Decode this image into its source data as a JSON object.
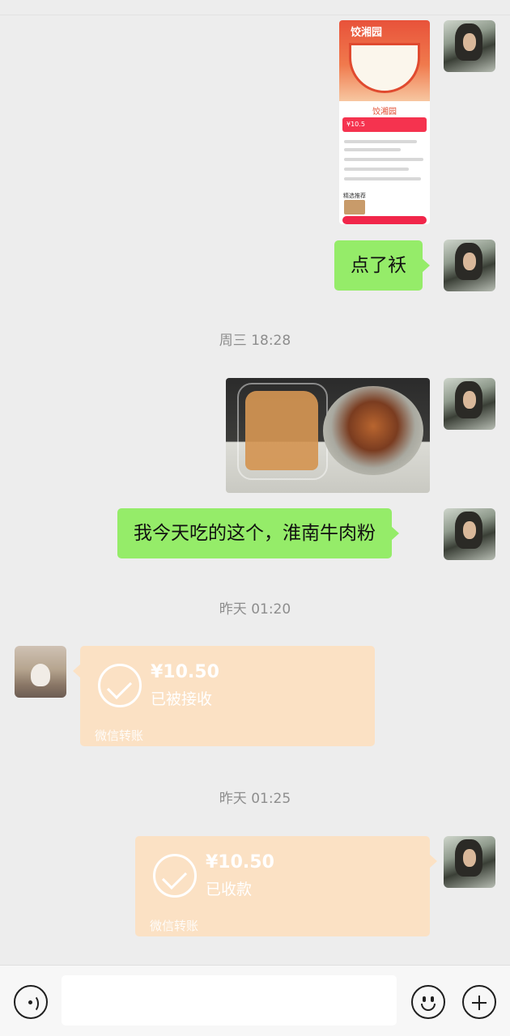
{
  "messages": {
    "screenshot": {
      "title": "饺湘园",
      "subtitle": "饺湘园",
      "price_text": "¥10.5",
      "recommend_label": "精选推荐"
    },
    "msg1": "点了袄",
    "time1": "周三 18:28",
    "msg2": "我今天吃的这个，淮南牛肉粉",
    "time2": "昨天 01:20",
    "transfer1": {
      "amount": "¥10.50",
      "status": "已被接收",
      "label": "微信转账"
    },
    "time3": "昨天 01:25",
    "transfer2": {
      "amount": "¥10.50",
      "status": "已收款",
      "label": "微信转账"
    }
  },
  "input_bar": {
    "voice_icon": "voice-icon",
    "emoji_icon": "emoji-icon",
    "plus_icon": "plus-icon",
    "input_value": ""
  },
  "colors": {
    "chat_background": "#ededed",
    "sent_bubble": "#95ec69",
    "transfer_card": "#fbe1c4"
  }
}
